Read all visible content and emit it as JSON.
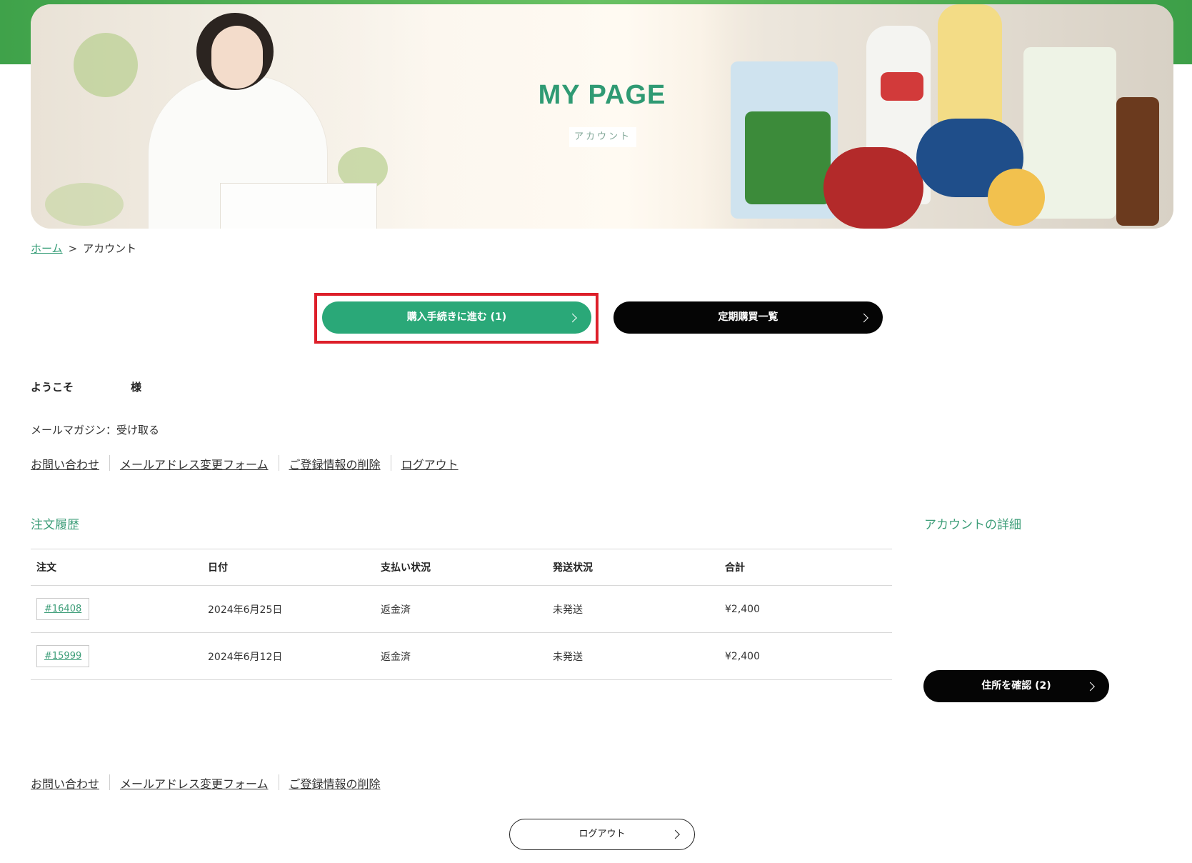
{
  "hero": {
    "title": "MY PAGE",
    "subtitle": "アカウント"
  },
  "breadcrumb": {
    "home": "ホーム",
    "separator": ">",
    "current": "アカウント"
  },
  "buttons": {
    "checkout": "購入手続きに進む (1)",
    "subscriptions": "定期購買一覧",
    "confirm_address": "住所を確認 (2)",
    "logout": "ログアウト"
  },
  "welcome": {
    "prefix": "ようこそ",
    "suffix": "様"
  },
  "newsletter": "メールマガジン：受け取る",
  "links_top": [
    "お問い合わせ",
    "メールアドレス変更フォーム",
    "ご登録情報の削除",
    "ログアウト"
  ],
  "links_bottom": [
    "お問い合わせ",
    "メールアドレス変更フォーム",
    "ご登録情報の削除"
  ],
  "orders": {
    "title": "注文履歴",
    "headers": [
      "注文",
      "日付",
      "支払い状況",
      "発送状況",
      "合計"
    ],
    "rows": [
      {
        "order": "#16408",
        "date": "2024年6月25日",
        "payment": "返金済",
        "shipping": "未発送",
        "total": "¥2,400"
      },
      {
        "order": "#15999",
        "date": "2024年6月12日",
        "payment": "返金済",
        "shipping": "未発送",
        "total": "¥2,400"
      }
    ]
  },
  "account": {
    "title": "アカウントの詳細"
  },
  "colors": {
    "accent": "#2aa878",
    "heading_green": "#3e9e79",
    "highlight_frame": "#dd1f2a",
    "dark_button": "#050505"
  },
  "icons": [
    "chevron-right-icon"
  ]
}
